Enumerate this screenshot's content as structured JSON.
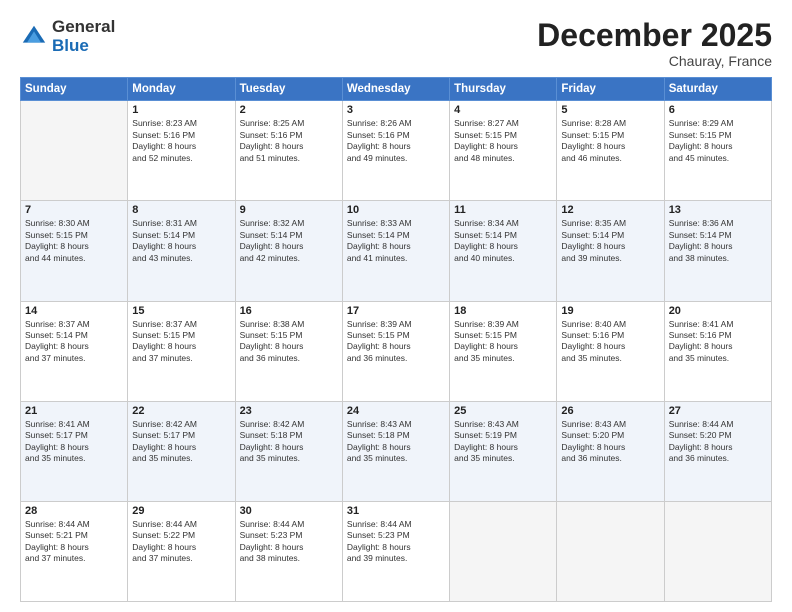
{
  "logo": {
    "general": "General",
    "blue": "Blue"
  },
  "header": {
    "month": "December 2025",
    "location": "Chauray, France"
  },
  "days_of_week": [
    "Sunday",
    "Monday",
    "Tuesday",
    "Wednesday",
    "Thursday",
    "Friday",
    "Saturday"
  ],
  "weeks": [
    [
      {
        "day": "",
        "info": ""
      },
      {
        "day": "1",
        "info": "Sunrise: 8:23 AM\nSunset: 5:16 PM\nDaylight: 8 hours\nand 52 minutes."
      },
      {
        "day": "2",
        "info": "Sunrise: 8:25 AM\nSunset: 5:16 PM\nDaylight: 8 hours\nand 51 minutes."
      },
      {
        "day": "3",
        "info": "Sunrise: 8:26 AM\nSunset: 5:16 PM\nDaylight: 8 hours\nand 49 minutes."
      },
      {
        "day": "4",
        "info": "Sunrise: 8:27 AM\nSunset: 5:15 PM\nDaylight: 8 hours\nand 48 minutes."
      },
      {
        "day": "5",
        "info": "Sunrise: 8:28 AM\nSunset: 5:15 PM\nDaylight: 8 hours\nand 46 minutes."
      },
      {
        "day": "6",
        "info": "Sunrise: 8:29 AM\nSunset: 5:15 PM\nDaylight: 8 hours\nand 45 minutes."
      }
    ],
    [
      {
        "day": "7",
        "info": "Sunrise: 8:30 AM\nSunset: 5:15 PM\nDaylight: 8 hours\nand 44 minutes."
      },
      {
        "day": "8",
        "info": "Sunrise: 8:31 AM\nSunset: 5:14 PM\nDaylight: 8 hours\nand 43 minutes."
      },
      {
        "day": "9",
        "info": "Sunrise: 8:32 AM\nSunset: 5:14 PM\nDaylight: 8 hours\nand 42 minutes."
      },
      {
        "day": "10",
        "info": "Sunrise: 8:33 AM\nSunset: 5:14 PM\nDaylight: 8 hours\nand 41 minutes."
      },
      {
        "day": "11",
        "info": "Sunrise: 8:34 AM\nSunset: 5:14 PM\nDaylight: 8 hours\nand 40 minutes."
      },
      {
        "day": "12",
        "info": "Sunrise: 8:35 AM\nSunset: 5:14 PM\nDaylight: 8 hours\nand 39 minutes."
      },
      {
        "day": "13",
        "info": "Sunrise: 8:36 AM\nSunset: 5:14 PM\nDaylight: 8 hours\nand 38 minutes."
      }
    ],
    [
      {
        "day": "14",
        "info": "Sunrise: 8:37 AM\nSunset: 5:14 PM\nDaylight: 8 hours\nand 37 minutes."
      },
      {
        "day": "15",
        "info": "Sunrise: 8:37 AM\nSunset: 5:15 PM\nDaylight: 8 hours\nand 37 minutes."
      },
      {
        "day": "16",
        "info": "Sunrise: 8:38 AM\nSunset: 5:15 PM\nDaylight: 8 hours\nand 36 minutes."
      },
      {
        "day": "17",
        "info": "Sunrise: 8:39 AM\nSunset: 5:15 PM\nDaylight: 8 hours\nand 36 minutes."
      },
      {
        "day": "18",
        "info": "Sunrise: 8:39 AM\nSunset: 5:15 PM\nDaylight: 8 hours\nand 35 minutes."
      },
      {
        "day": "19",
        "info": "Sunrise: 8:40 AM\nSunset: 5:16 PM\nDaylight: 8 hours\nand 35 minutes."
      },
      {
        "day": "20",
        "info": "Sunrise: 8:41 AM\nSunset: 5:16 PM\nDaylight: 8 hours\nand 35 minutes."
      }
    ],
    [
      {
        "day": "21",
        "info": "Sunrise: 8:41 AM\nSunset: 5:17 PM\nDaylight: 8 hours\nand 35 minutes."
      },
      {
        "day": "22",
        "info": "Sunrise: 8:42 AM\nSunset: 5:17 PM\nDaylight: 8 hours\nand 35 minutes."
      },
      {
        "day": "23",
        "info": "Sunrise: 8:42 AM\nSunset: 5:18 PM\nDaylight: 8 hours\nand 35 minutes."
      },
      {
        "day": "24",
        "info": "Sunrise: 8:43 AM\nSunset: 5:18 PM\nDaylight: 8 hours\nand 35 minutes."
      },
      {
        "day": "25",
        "info": "Sunrise: 8:43 AM\nSunset: 5:19 PM\nDaylight: 8 hours\nand 35 minutes."
      },
      {
        "day": "26",
        "info": "Sunrise: 8:43 AM\nSunset: 5:20 PM\nDaylight: 8 hours\nand 36 minutes."
      },
      {
        "day": "27",
        "info": "Sunrise: 8:44 AM\nSunset: 5:20 PM\nDaylight: 8 hours\nand 36 minutes."
      }
    ],
    [
      {
        "day": "28",
        "info": "Sunrise: 8:44 AM\nSunset: 5:21 PM\nDaylight: 8 hours\nand 37 minutes."
      },
      {
        "day": "29",
        "info": "Sunrise: 8:44 AM\nSunset: 5:22 PM\nDaylight: 8 hours\nand 37 minutes."
      },
      {
        "day": "30",
        "info": "Sunrise: 8:44 AM\nSunset: 5:23 PM\nDaylight: 8 hours\nand 38 minutes."
      },
      {
        "day": "31",
        "info": "Sunrise: 8:44 AM\nSunset: 5:23 PM\nDaylight: 8 hours\nand 39 minutes."
      },
      {
        "day": "",
        "info": ""
      },
      {
        "day": "",
        "info": ""
      },
      {
        "day": "",
        "info": ""
      }
    ]
  ]
}
